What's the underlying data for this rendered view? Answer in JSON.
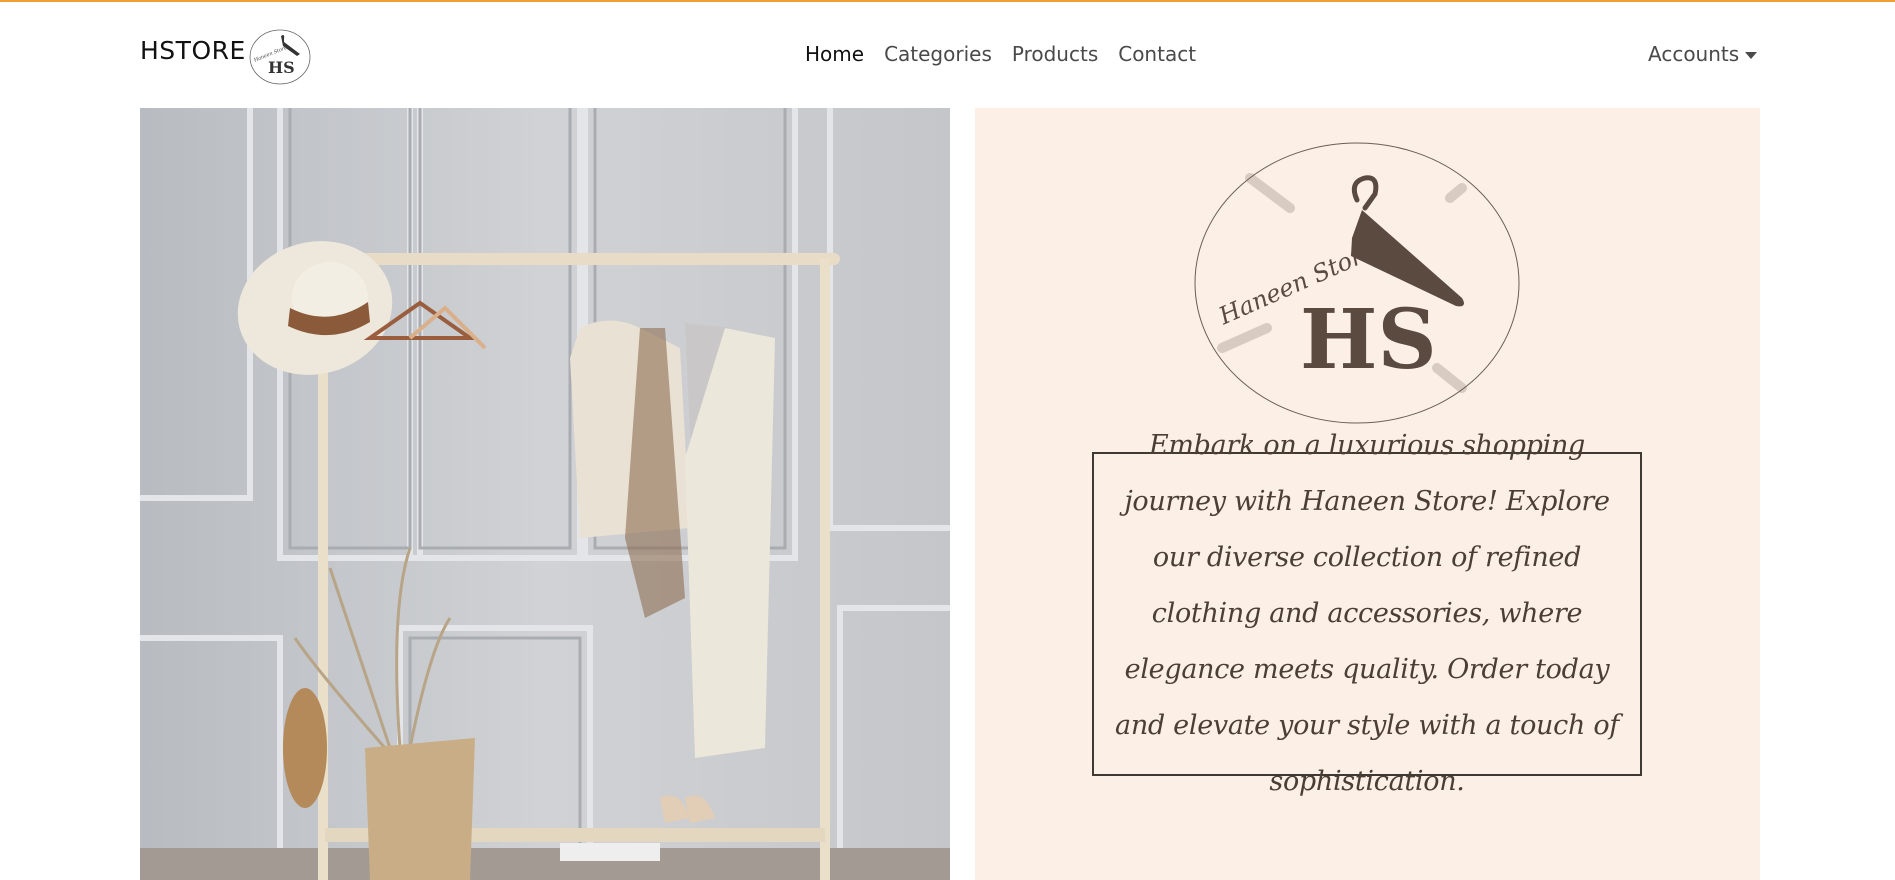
{
  "navbar": {
    "brand": "HSTORE",
    "links": [
      {
        "label": "Home",
        "active": true
      },
      {
        "label": "Categories",
        "active": false
      },
      {
        "label": "Products",
        "active": false
      },
      {
        "label": "Contact",
        "active": false
      }
    ],
    "accounts_label": "Accounts"
  },
  "logo": {
    "script_text": "Haneen Store",
    "monogram": "HS"
  },
  "hero": {
    "tagline": "Embark on a luxurious shopping journey with Haneen Store! Explore our diverse collection of refined clothing and accessories, where elegance meets quality. Order today and elevate your style with a touch of sophistication."
  },
  "colors": {
    "accent_topline": "#f0a030",
    "panel_bg": "#fcf0e6",
    "logo_brown": "#5a4a40"
  }
}
